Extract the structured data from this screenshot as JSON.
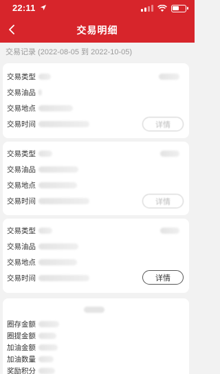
{
  "status": {
    "time": "22:11"
  },
  "nav": {
    "title": "交易明细"
  },
  "range": {
    "text": "交易记录 (2022-08-05 到 2022-10-05)"
  },
  "labels": {
    "type": "交易类型",
    "oil": "交易油品",
    "place": "交易地点",
    "time": "交易时间"
  },
  "detail_label": "详情",
  "summary_labels": [
    "圈存金额",
    "圈提金额",
    "加油金额",
    "加油数量",
    "奖励积分"
  ],
  "colors": {
    "accent": "#d7252b"
  }
}
